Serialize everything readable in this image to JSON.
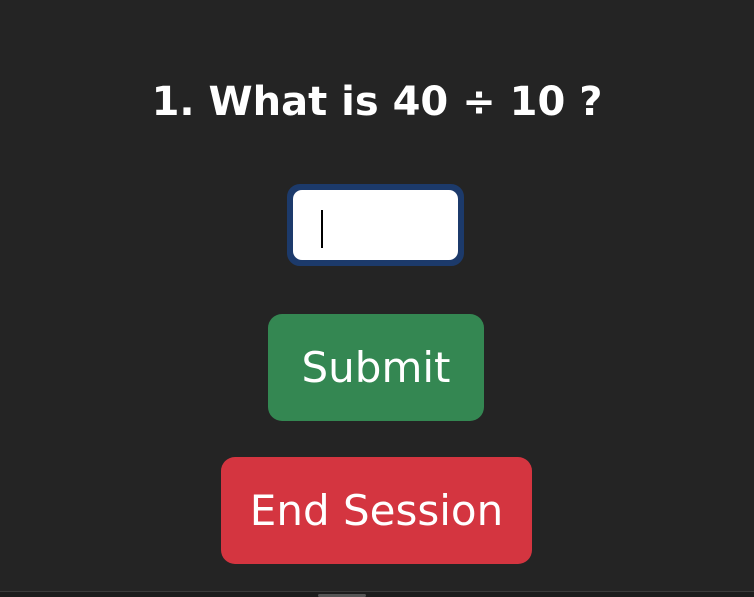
{
  "quiz": {
    "question_text": "1. What is 40 ÷ 10 ?",
    "answer_value": "",
    "submit_label": "Submit",
    "end_session_label": "End Session"
  },
  "colors": {
    "background": "#242424",
    "submit": "#348752",
    "end_session": "#d43540",
    "input_focus_ring": "#1c3a6b"
  }
}
